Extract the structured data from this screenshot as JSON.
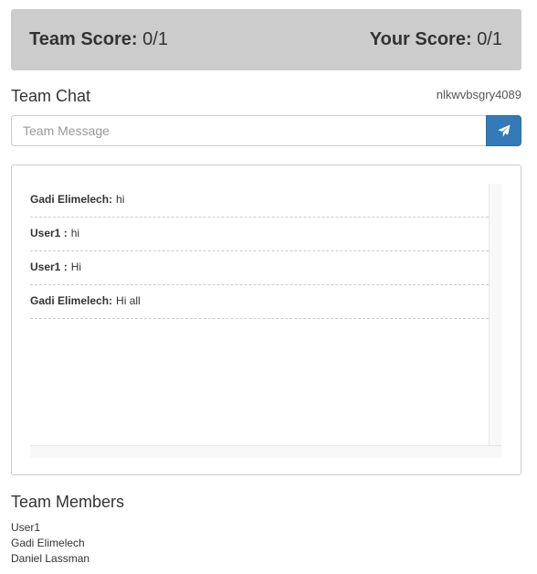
{
  "scores": {
    "team_label": "Team Score:",
    "team_value": "0/1",
    "your_label": "Your Score:",
    "your_value": "0/1"
  },
  "chat": {
    "title": "Team Chat",
    "team_code": "nlkwvbsgry4089",
    "input_placeholder": "Team Message",
    "send_icon": "paper-plane-icon",
    "messages": [
      {
        "sender": "Gadi Elimelech:",
        "text": "hi"
      },
      {
        "sender": "User1 :",
        "text": "hi"
      },
      {
        "sender": "User1 :",
        "text": "Hi"
      },
      {
        "sender": "Gadi Elimelech:",
        "text": "Hi all"
      }
    ]
  },
  "members": {
    "title": "Team Members",
    "list": [
      "User1",
      "Gadi Elimelech",
      "Daniel Lassman"
    ]
  },
  "colors": {
    "score_bar_bg": "#cccccc",
    "send_button": "#337ab7"
  }
}
